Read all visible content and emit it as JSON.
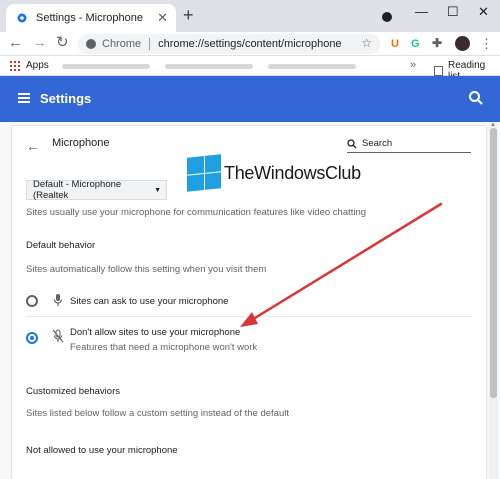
{
  "browser": {
    "tab_title": "Settings - Microphone",
    "new_tab_symbol": "+",
    "close_symbol": "✕",
    "window_controls": [
      "—",
      "☐",
      "✕"
    ],
    "omnibox": {
      "site_label": "Chrome",
      "url": "chrome://settings/content/microphone"
    },
    "bookmarks": {
      "apps_label": "Apps",
      "more_symbol": "»",
      "reading_list_label": "Reading list"
    }
  },
  "settings_header": {
    "title": "Settings"
  },
  "page": {
    "heading": "Microphone",
    "search_placeholder": "Search",
    "watermark_logo_text": "TheWindowsClub",
    "device_select": "Default - Microphone (Realtek",
    "description": "Sites usually use your microphone for communication features like video chatting",
    "default_behavior": {
      "title": "Default behavior",
      "subtitle": "Sites automatically follow this setting when you visit them",
      "options": [
        {
          "label": "Sites can ask to use your microphone",
          "selected": false,
          "icon": "microphone-icon"
        },
        {
          "label": "Don't allow sites to use your microphone",
          "sublabel": "Features that need a microphone won't work",
          "selected": true,
          "icon": "microphone-off-icon"
        }
      ]
    },
    "customized_behaviors": {
      "title": "Customized behaviors",
      "subtitle": "Sites listed below follow a custom setting instead of the default",
      "not_allowed_title": "Not allowed to use your microphone"
    }
  },
  "colors": {
    "header_blue": "#3367d6",
    "radio_selected": "#1a73e8",
    "annotation_arrow": "#d93636"
  }
}
